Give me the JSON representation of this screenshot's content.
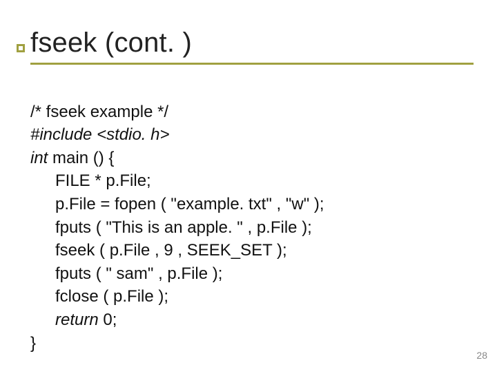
{
  "slide": {
    "title": "fseek (cont. )",
    "page_number": "28"
  },
  "code": {
    "l1": "/* fseek example */",
    "l2a": "#include",
    "l2b": " <stdio. h>",
    "l3a": "int",
    "l3b": " main () {",
    "l4": "FILE * p.File;",
    "l5": "p.File = fopen ( \"example. txt\" , \"w\" );",
    "l6": "fputs ( \"This is an apple. \" , p.File );",
    "l7": "fseek ( p.File , 9 , SEEK_SET );",
    "l8": "fputs ( \" sam\" , p.File );",
    "l9": "fclose ( p.File );",
    "l10a": "return",
    "l10b": " 0;",
    "l11": "}"
  }
}
